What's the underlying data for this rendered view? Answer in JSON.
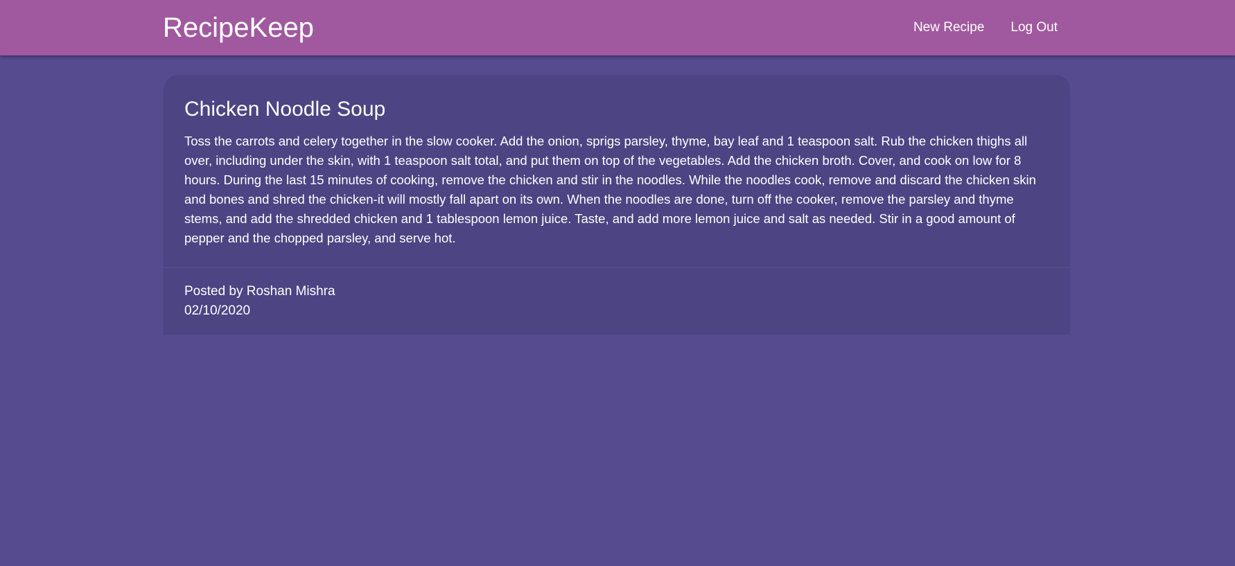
{
  "header": {
    "brand": "RecipeKeep",
    "nav": {
      "new_recipe": "New Recipe",
      "log_out": "Log Out"
    }
  },
  "recipe": {
    "title": "Chicken Noodle Soup",
    "description": "Toss the carrots and celery together in the slow cooker. Add the onion, sprigs parsley, thyme, bay leaf and 1 teaspoon salt. Rub the chicken thighs all over, including under the skin, with 1 teaspoon salt total, and put them on top of the vegetables. Add the chicken broth. Cover, and cook on low for 8 hours. During the last 15 minutes of cooking, remove the chicken and stir in the noodles. While the noodles cook, remove and discard the chicken skin and bones and shred the chicken-it will mostly fall apart on its own. When the noodles are done, turn off the cooker, remove the parsley and thyme stems, and add the shredded chicken and 1 tablespoon lemon juice. Taste, and add more lemon juice and salt as needed. Stir in a good amount of pepper and the chopped parsley, and serve hot.",
    "posted_by": "Posted by Roshan Mishra",
    "date": "02/10/2020"
  },
  "colors": {
    "background": "#554b8e",
    "navbar": "#a0599e",
    "card": "#4c4483",
    "text": "#ffffff"
  }
}
